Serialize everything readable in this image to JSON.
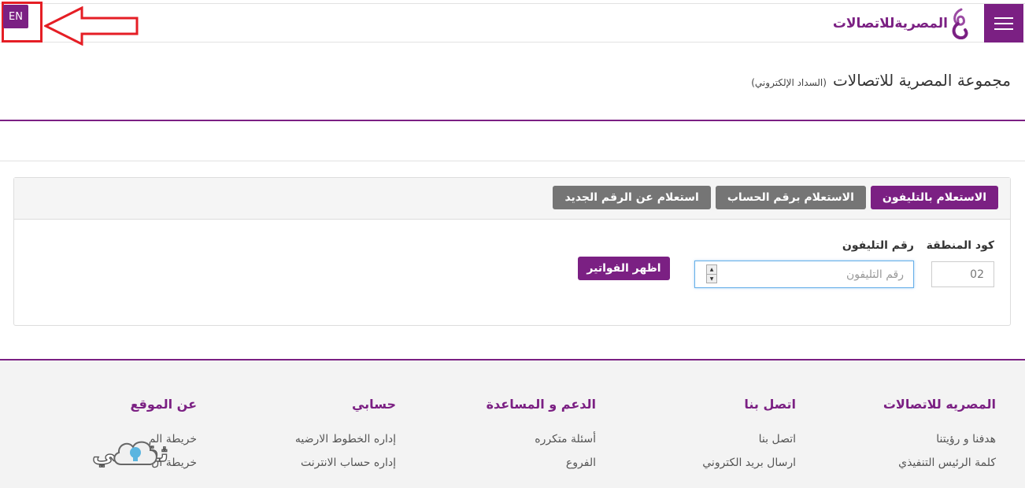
{
  "header": {
    "logo_text": "المصريةللاتصالات",
    "lang_label": "EN",
    "colors": {
      "brand": "#7b2083",
      "highlight": "#e51e25"
    }
  },
  "page": {
    "title": "مجموعة المصرية للاتصالات",
    "subtitle": "(السداد الإلكتروني)"
  },
  "tabs": [
    {
      "label": "الاستعلام بالتليفون",
      "active": true
    },
    {
      "label": "الاستعلام برقم الحساب",
      "active": false
    },
    {
      "label": "استعلام عن الرقم الجديد",
      "active": false
    }
  ],
  "form": {
    "area_code_label": "كود المنطقة",
    "area_code_value": "02",
    "phone_label": "رقم التليفون",
    "phone_placeholder": "رقم التليفون",
    "submit_label": "اظهر الفواتير"
  },
  "footer": {
    "columns": [
      {
        "heading": "المصريه للاتصالات",
        "links": [
          "هدفنا و رؤيتنا",
          "كلمة الرئيس التنفيذي"
        ]
      },
      {
        "heading": "اتصل بنا",
        "links": [
          "اتصل بنا",
          "ارسال بريد الكتروني"
        ]
      },
      {
        "heading": "الدعم و المساعدة",
        "links": [
          "أسئلة متكرره",
          "الفروع"
        ]
      },
      {
        "heading": "حسابي",
        "links": [
          "إداره الخطوط الارضيه",
          "إداره حساب الانترنت"
        ]
      },
      {
        "heading": "عن الموقع",
        "links": [
          "خريطة الم",
          "خريطة ال"
        ]
      }
    ]
  },
  "watermark": {
    "text": "ثقفني"
  }
}
